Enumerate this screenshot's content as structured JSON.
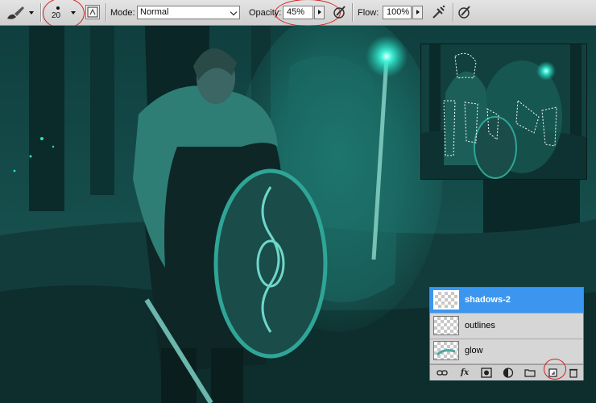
{
  "options_bar": {
    "brush_size": "20",
    "mode_label": "Mode:",
    "mode_value": "Normal",
    "opacity_label": "Opacity:",
    "opacity_value": "45%",
    "flow_label": "Flow:",
    "flow_value": "100%"
  },
  "annotations": {
    "highlight_color": "#d21e1e"
  },
  "layers_panel": {
    "layers": [
      {
        "name": "shadows-2",
        "selected": true
      },
      {
        "name": "outlines",
        "selected": false
      },
      {
        "name": "glow",
        "selected": false
      }
    ],
    "footer_icons": [
      "link-icon",
      "fx-icon",
      "mask-icon",
      "adjustment-icon",
      "folder-icon",
      "new-layer-icon",
      "trash-icon"
    ],
    "footer_fx_label": "fx",
    "selected_color": "#3c96f0"
  },
  "scene": {
    "accent_glow": "#21e6c8"
  }
}
